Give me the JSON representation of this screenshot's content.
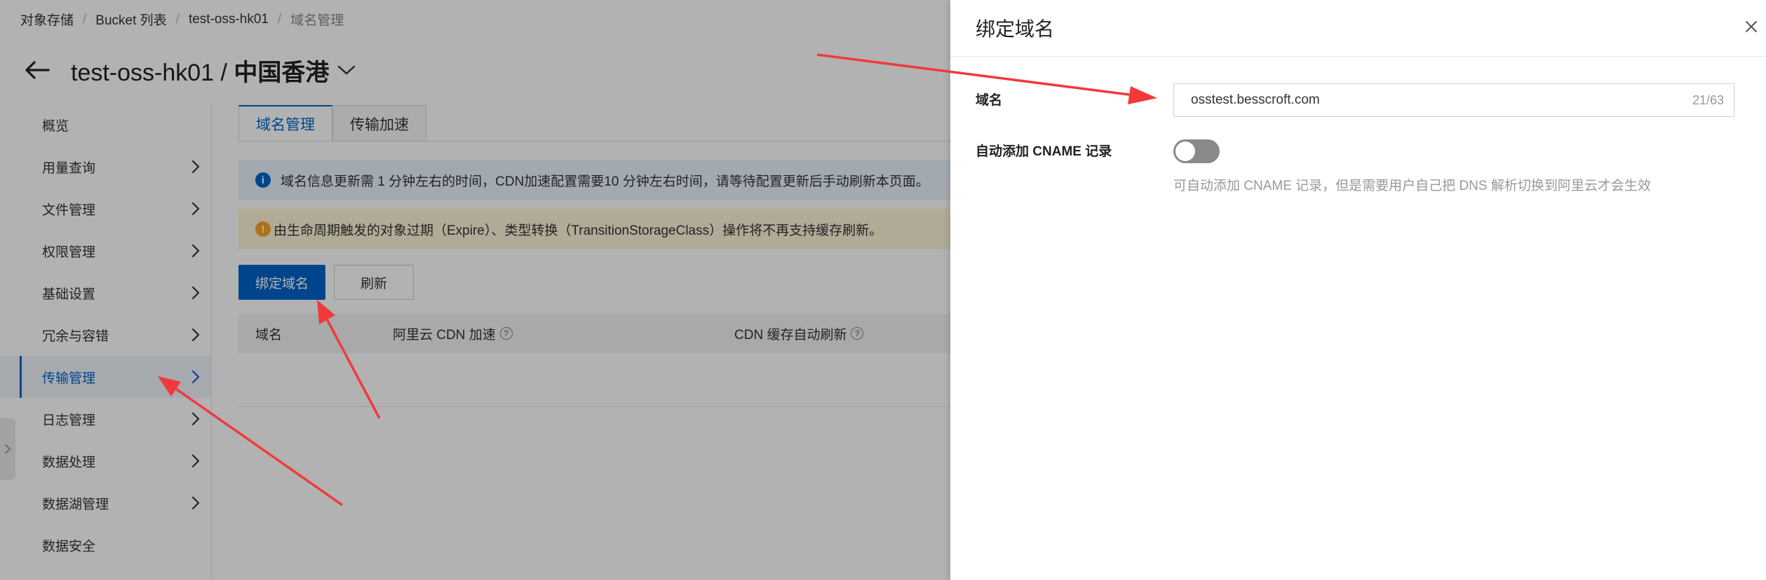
{
  "breadcrumb": [
    "对象存储",
    "Bucket 列表",
    "test-oss-hk01",
    "域名管理"
  ],
  "header": {
    "bucket": "test-oss-hk01 / ",
    "region": "中国香港"
  },
  "sidebar": {
    "items": [
      {
        "label": "概览",
        "has_arrow": false
      },
      {
        "label": "用量查询",
        "has_arrow": true
      },
      {
        "label": "文件管理",
        "has_arrow": true
      },
      {
        "label": "权限管理",
        "has_arrow": true
      },
      {
        "label": "基础设置",
        "has_arrow": true
      },
      {
        "label": "冗余与容错",
        "has_arrow": true
      },
      {
        "label": "传输管理",
        "has_arrow": true,
        "active": true
      },
      {
        "label": "日志管理",
        "has_arrow": true
      },
      {
        "label": "数据处理",
        "has_arrow": true
      },
      {
        "label": "数据湖管理",
        "has_arrow": true
      },
      {
        "label": "数据安全",
        "has_arrow": false
      }
    ]
  },
  "tabs": [
    {
      "label": "域名管理",
      "active": true
    },
    {
      "label": "传输加速",
      "active": false
    }
  ],
  "notices": {
    "info": "域名信息更新需 1 分钟左右的时间，CDN加速配置需要10 分钟左右时间，请等待配置更新后手动刷新本页面。",
    "warn": "由生命周期触发的对象过期（Expire）、类型转换（TransitionStorageClass）操作将不再支持缓存刷新。"
  },
  "buttons": {
    "bind": "绑定域名",
    "refresh": "刷新"
  },
  "table": {
    "columns": [
      "域名",
      "阿里云 CDN 加速",
      "CDN 缓存自动刷新"
    ]
  },
  "drawer": {
    "title": "绑定域名",
    "domain_label": "域名",
    "domain_value": "osstest.besscroft.com",
    "domain_count": "21/63",
    "cname_label": "自动添加 CNAME 记录",
    "cname_enabled": false,
    "cname_hint": "可自动添加 CNAME 记录，但是需要用户自己把 DNS 解析切换到阿里云才会生效"
  },
  "colors": {
    "primary": "#0064c8",
    "annotation_arrow": "#f03a3a",
    "warning": "#f5a623"
  },
  "icons": [
    "back-arrow-icon",
    "chevron-down-icon",
    "chevron-right-icon",
    "info-icon",
    "warning-icon",
    "help-icon",
    "close-icon"
  ]
}
